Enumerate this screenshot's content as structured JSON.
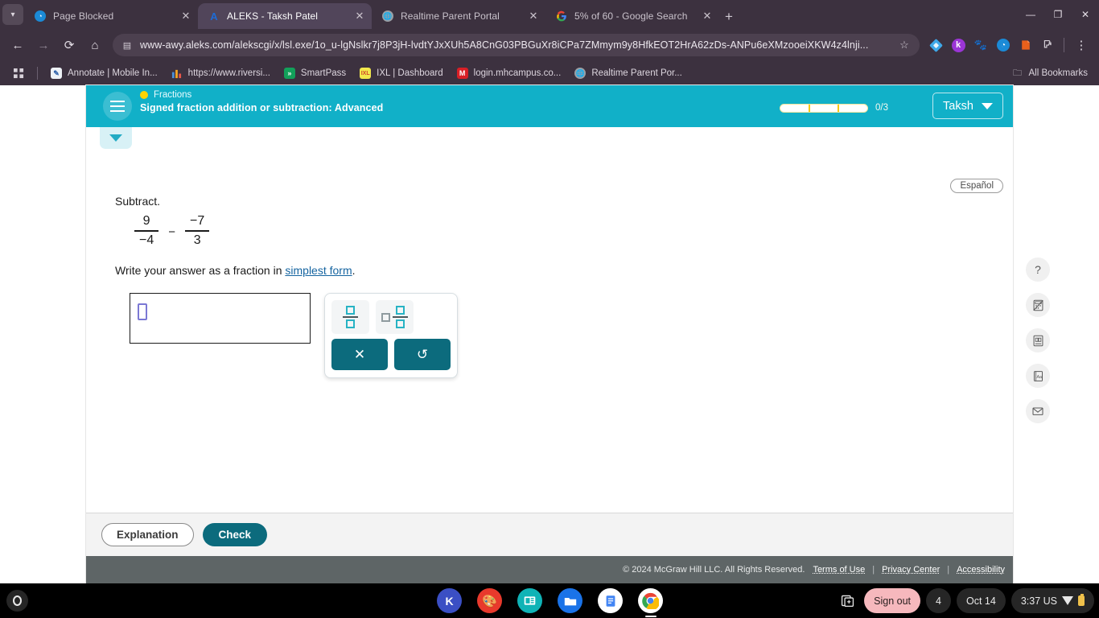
{
  "browser": {
    "tabs": [
      {
        "title": "Page Blocked",
        "favicon": "shield-icon",
        "active": false
      },
      {
        "title": "ALEKS - Taksh Patel",
        "favicon": "aleks-icon",
        "active": true
      },
      {
        "title": "Realtime Parent Portal",
        "favicon": "globe-icon",
        "active": false
      },
      {
        "title": "5% of 60 - Google Search",
        "favicon": "google-icon",
        "active": false
      }
    ],
    "new_tab_label": "+",
    "window_controls": {
      "minimize": "—",
      "maximize": "❐",
      "close": "✕"
    },
    "nav": {
      "back": "←",
      "forward": "→",
      "reload": "⟳",
      "home": "⌂"
    },
    "omnibox": {
      "url": "www-awy.aleks.com/alekscgi/x/lsl.exe/1o_u-lgNslkr7j8P3jH-lvdtYJxXUh5A8CnG03PBGuXr8iCPa7ZMmym9y8HfkEOT2HrA62zDs-ANPu6eXMzooeiXKW4z4lnji...",
      "site_icon": "page-info-icon",
      "star": "☆"
    },
    "extensions": [
      "diamond-extension-icon",
      "kami-extension-icon",
      "cat-extension-icon",
      "droplet-extension-icon",
      "book-extension-icon",
      "puzzle-piece-icon"
    ],
    "menu": "⋮",
    "bookmarks": [
      {
        "label": "Annotate | Mobile In...",
        "icon": "annotate-icon"
      },
      {
        "label": "https://www.riversi...",
        "icon": "chart-icon"
      },
      {
        "label": "SmartPass",
        "icon": "smartpass-icon"
      },
      {
        "label": "IXL | Dashboard",
        "icon": "ixl-icon"
      },
      {
        "label": "login.mhcampus.co...",
        "icon": "mcgraw-icon"
      },
      {
        "label": "Realtime Parent Por...",
        "icon": "globe-icon"
      }
    ],
    "apps_grid": "apps-grid-icon",
    "all_bookmarks": {
      "label": "All Bookmarks",
      "icon": "folder-icon"
    }
  },
  "aleks": {
    "header": {
      "menu_icon": "hamburger-icon",
      "topic": "Fractions",
      "title": "Signed fraction addition or subtraction: Advanced",
      "progress": {
        "count": "0/3",
        "segments": 3,
        "filled": 0
      },
      "user": "Taksh"
    },
    "collapse_icon": "chevron-down-icon",
    "espanol_label": "Español",
    "problem": {
      "prompt": "Subtract.",
      "expression": {
        "left": {
          "numerator": "9",
          "denominator": "−4"
        },
        "operator": "−",
        "right": {
          "numerator": "−7",
          "denominator": "3"
        }
      },
      "instruction_before": "Write your answer as a fraction in ",
      "instruction_link": "simplest form",
      "instruction_after": "."
    },
    "answer": {
      "value": "",
      "placeholder_slot": "empty-box"
    },
    "keypad": {
      "fraction_button": "fraction-template",
      "mixed_number_button": "mixed-number-template",
      "clear_button": "✕",
      "undo_button": "↺"
    },
    "tools": [
      {
        "name": "help-icon",
        "glyph": "?"
      },
      {
        "name": "calculator-disabled-icon",
        "glyph": "▤"
      },
      {
        "name": "reference-book-icon",
        "glyph": "▤"
      },
      {
        "name": "glossary-icon",
        "glyph": "Aa"
      },
      {
        "name": "message-icon",
        "glyph": "✉"
      }
    ],
    "footer": {
      "explanation": "Explanation",
      "check": "Check"
    },
    "legal": {
      "copyright": "© 2024 McGraw Hill LLC. All Rights Reserved.",
      "terms": "Terms of Use",
      "privacy": "Privacy Center",
      "accessibility": "Accessibility",
      "separator": "|"
    }
  },
  "shelf": {
    "launcher": "launcher-icon",
    "apps": [
      {
        "name": "kami-app",
        "label": "K",
        "color": "#3b4fc4",
        "running": false
      },
      {
        "name": "art-app",
        "label": "🎨",
        "color": "#e8392c",
        "running": false
      },
      {
        "name": "news-app",
        "label": "▤",
        "color": "#0fb3b6",
        "running": false
      },
      {
        "name": "files-app",
        "label": "▰",
        "color": "#1a73e8",
        "running": false
      },
      {
        "name": "docs-app",
        "label": "▤",
        "color": "#ffffff",
        "running": false
      },
      {
        "name": "chrome-app",
        "label": "◉",
        "color": "#ffffff",
        "running": true
      }
    ],
    "screen_capture": "screen-capture-icon",
    "sign_out": "Sign out",
    "notification_count": "4",
    "date": "Oct 14",
    "time": "3:37 US",
    "wifi": "wifi-icon",
    "battery": "battery-icon"
  },
  "colors": {
    "aleks_teal": "#11b0c8",
    "button_teal": "#0c6b7d",
    "browser_chrome": "#3c313f",
    "accent_yellow": "#ffd400"
  }
}
